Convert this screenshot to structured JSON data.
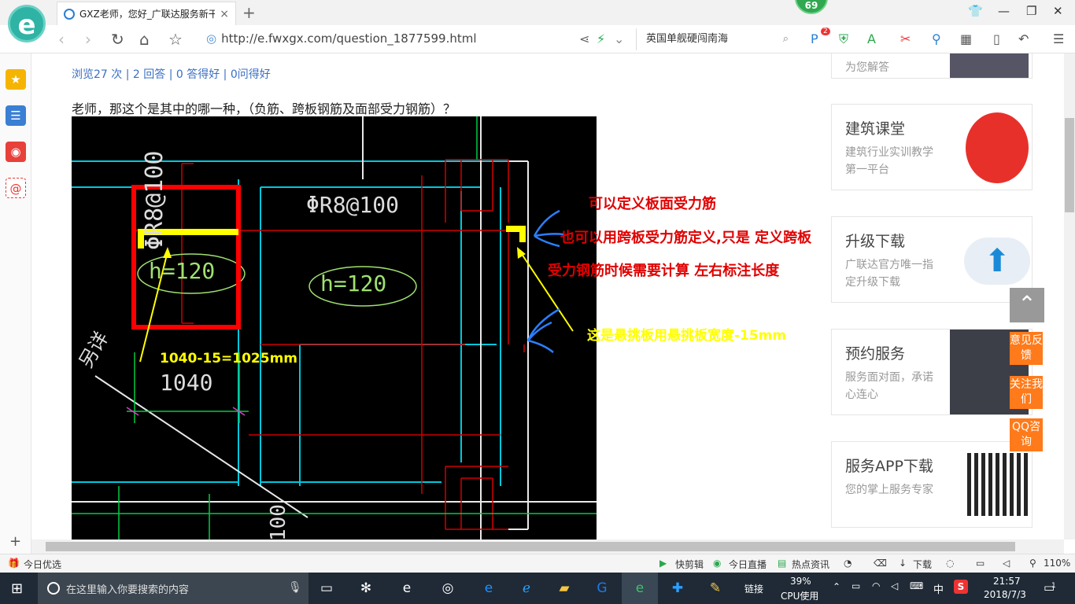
{
  "browser": {
    "tab_title": "GXZ老师，您好_广联达服务新干线",
    "tab_close": "×",
    "new_tab": "+",
    "badge": "69",
    "url": "http://e.fwxgx.com/question_1877599.html",
    "search_text": "英国单舰硬闯南海",
    "toolbar_badge": "2"
  },
  "page": {
    "stats": "浏览27 次 | 2 回答 | 0 答得好 | 0问得好",
    "question": "老师，那这个是其中的哪一种，（负筋、跨板钢筋及面部受力钢筋）？"
  },
  "cad": {
    "label_top_vertical": "ΦR8@100",
    "label_rebar": "ΦR8@100",
    "label_h1": "h=120",
    "label_h2": "h=120",
    "label_dim": "1040",
    "label_bottom": "100",
    "label_side": "另详",
    "ann_red_1": "可以定义板面受力筋",
    "ann_red_2": "也可以用跨板受力筋定义,只是  定义跨板",
    "ann_red_3": "受力钢筋时候需要计算 左右标注长度",
    "ann_yellow_calc": "1040-15=1025mm",
    "ann_yellow_note": "这是悬挑板用悬挑板宽度-15mm"
  },
  "sidebar_cards": [
    {
      "title": "",
      "desc": "为您解答"
    },
    {
      "title": "建筑课堂",
      "desc": "建筑行业实训教学第一平台"
    },
    {
      "title": "升级下载",
      "desc": "广联达官方唯一指定升级下载"
    },
    {
      "title": "预约服务",
      "desc": "服务面对面，承诺心连心"
    },
    {
      "title": "服务APP下载",
      "desc": "您的掌上服务专家"
    }
  ],
  "float_buttons": [
    "意见反馈",
    "关注我们",
    "QQ咨询"
  ],
  "statusbar": {
    "left": "今日优选",
    "items": [
      "快剪辑",
      "今日直播",
      "热点资讯",
      "下载"
    ],
    "zoom": "110%"
  },
  "taskbar": {
    "search_placeholder": "在这里输入你要搜索的内容",
    "links": "链接",
    "cpu_value": "39%",
    "cpu_label": "CPU使用",
    "ime": "中",
    "time": "21:57",
    "date": "2018/7/3",
    "notifications": "1"
  },
  "colors": {
    "accent_blue": "#3a6fc4",
    "annotation_red": "#e00000",
    "annotation_yellow": "#ffff00",
    "float_orange": "#ff7a1a",
    "cad_green": "#00cc44",
    "cad_cyan": "#00d0e0"
  }
}
